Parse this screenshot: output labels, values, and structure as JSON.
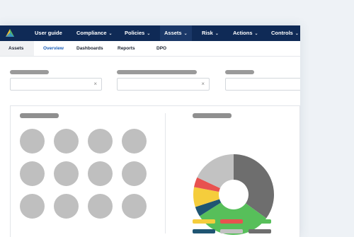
{
  "topnav": {
    "items": [
      {
        "label": "User guide",
        "chevron": false
      },
      {
        "label": "Compliance",
        "chevron": true
      },
      {
        "label": "Policies",
        "chevron": true
      },
      {
        "label": "Assets",
        "chevron": true
      },
      {
        "label": "Risk",
        "chevron": true
      },
      {
        "label": "Actions",
        "chevron": true
      },
      {
        "label": "Controls",
        "chevron": true
      }
    ],
    "active": "Assets",
    "colors": {
      "bar": "#0f2a56",
      "active": "#1b3868"
    }
  },
  "subnav": {
    "items": [
      "Assets",
      "Overview",
      "Dashboards",
      "Reports",
      "DPO"
    ],
    "active": "Overview"
  },
  "filters": [
    {
      "clear_icon": "×"
    },
    {
      "clear_icon": "×"
    },
    {
      "clear_icon": ""
    }
  ],
  "chart": {
    "type": "donut",
    "slices": [
      {
        "color": "#6e6e6e",
        "value": 35
      },
      {
        "color": "#57bf5a",
        "value": 31
      },
      {
        "color": "#1f5572",
        "value": 4
      },
      {
        "color": "#f5cd3c",
        "value": 8
      },
      {
        "color": "#e8524f",
        "value": 4
      },
      {
        "color": "#c2c2c2",
        "value": 18
      }
    ],
    "legend_colors": [
      "#f5cd3c",
      "#e8524f",
      "#57bf5a",
      "#1f5572",
      "#c2c2c2",
      "#6e6e6e"
    ]
  },
  "placeholder_color": "#bfbfbf"
}
